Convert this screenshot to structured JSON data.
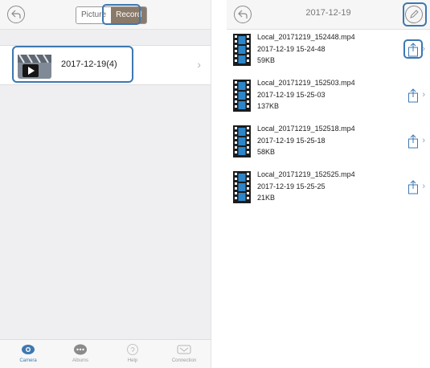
{
  "left_screen": {
    "segmented": {
      "pictures_label": "Picture",
      "record_label": "Record"
    },
    "album": {
      "label": "2017-12-19(4)"
    },
    "tabs": [
      {
        "label": "Camera",
        "icon": "camera-icon"
      },
      {
        "label": "Albums",
        "icon": "albums-icon"
      },
      {
        "label": "Help",
        "icon": "help-icon"
      },
      {
        "label": "Connection",
        "icon": "connection-icon"
      }
    ]
  },
  "right_screen": {
    "title": "2017-12-19",
    "files": [
      {
        "name": "Local_20171219_152448.mp4",
        "date": "2017-12-19 15-24-48",
        "size": "59KB"
      },
      {
        "name": "Local_20171219_152503.mp4",
        "date": "2017-12-19 15-25-03",
        "size": "137KB"
      },
      {
        "name": "Local_20171219_152518.mp4",
        "date": "2017-12-19 15-25-18",
        "size": "58KB"
      },
      {
        "name": "Local_20171219_152525.mp4",
        "date": "2017-12-19 15-25-25",
        "size": "21KB"
      }
    ]
  },
  "colors": {
    "accent": "#3d78b0",
    "record_tab": "#8a7a6a"
  }
}
